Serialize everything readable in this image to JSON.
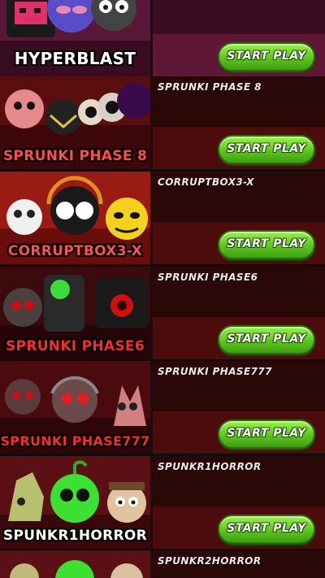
{
  "game_list": [
    {
      "title": "",
      "thumb_label": "HYPERBLAST",
      "button_label": "START PLAY",
      "thumb_bg": "#5a1838",
      "label_color": "#ffffff",
      "panel_top": "#3c0c22",
      "panel_band": "#5e1734"
    },
    {
      "title": "SPRUNKI PHASE 8",
      "thumb_label": "SPRUNKI PHASE 8",
      "button_label": "START PLAY",
      "thumb_bg": "#5a0e10",
      "label_color": "#ff4d4d",
      "panel_top": "#2a0808",
      "panel_band": "#4d0c0c"
    },
    {
      "title": "CORRUPTBOX3-X",
      "thumb_label": "CORRUPTBOX3-X",
      "button_label": "START PLAY",
      "thumb_bg": "#9a1a14",
      "label_color": "#ff5050",
      "panel_top": "#2a0808",
      "panel_band": "#4d0c0c"
    },
    {
      "title": "SPRUNKI PHASE6",
      "thumb_label": "SPRUNKI PHASE6",
      "button_label": "START PLAY",
      "thumb_bg": "#3a0a0c",
      "label_color": "#ff2a2a",
      "panel_top": "#2a0808",
      "panel_band": "#4d0c0c"
    },
    {
      "title": "SPRUNKI PHASE777",
      "thumb_label": "SPRUNKI PHASE777",
      "button_label": "START PLAY",
      "thumb_bg": "#4a0a0e",
      "label_color": "#ff2a2a",
      "panel_top": "#2a0808",
      "panel_band": "#4d0c0c"
    },
    {
      "title": "SPUNKR1HORROR",
      "thumb_label": "SPUNKR1HORROR",
      "button_label": "START PLAY",
      "thumb_bg": "#5a1014",
      "label_color": "#ffffff",
      "panel_top": "#2a0808",
      "panel_band": "#4d0c0c"
    },
    {
      "title": "SPUNKR2HORROR",
      "thumb_label": "",
      "button_label": "",
      "thumb_bg": "#5a1014",
      "label_color": "#ffffff",
      "panel_top": "#2a0808",
      "panel_band": "#4d0c0c"
    }
  ],
  "icons": [
    "hyperblast-characters-image",
    "phase8-characters-image",
    "corruptbox-characters-image",
    "phase6-characters-image",
    "phase777-characters-image",
    "horror-characters-image",
    "horror2-characters-image"
  ]
}
